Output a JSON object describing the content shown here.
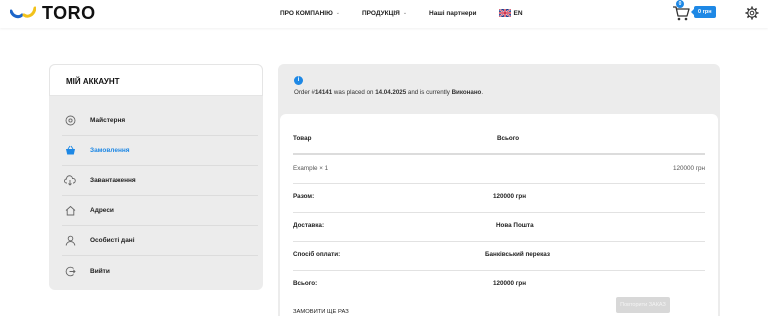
{
  "header": {
    "logo_text": "TORO",
    "nav": [
      {
        "label": "ПРО КОМПАНІЮ",
        "chevron": "⌄"
      },
      {
        "label": "ПРОДУКЦІЯ",
        "chevron": "⌄"
      },
      {
        "label": "Наші партнери",
        "chevron": ""
      }
    ],
    "lang": "EN",
    "cart_count": "0",
    "cart_total": "0 грн",
    "accent_color": "#1e88e5"
  },
  "sidebar": {
    "title": "МІЙ АККАУНТ",
    "items": [
      {
        "label": "Майстерня",
        "icon": "gauge-icon",
        "active": false
      },
      {
        "label": "Замовлення",
        "icon": "basket-icon",
        "active": true
      },
      {
        "label": "Завантаження",
        "icon": "cloud-download-icon",
        "active": false
      },
      {
        "label": "Адреси",
        "icon": "home-icon",
        "active": false
      },
      {
        "label": "Особисті дані",
        "icon": "user-icon",
        "active": false
      },
      {
        "label": "Вийти",
        "icon": "logout-icon",
        "active": false
      }
    ]
  },
  "order": {
    "notice_prefix": "Order #",
    "order_number": "14141",
    "notice_mid1": " was placed on ",
    "date": "14.04.2025",
    "notice_mid2": " and is currently ",
    "status": "Виконано",
    "notice_end": ".",
    "table": {
      "col_product": "Товар",
      "col_total": "Всього",
      "item_name": "Example × 1",
      "item_total": "120000 грн",
      "rows": [
        {
          "label": "Разом:",
          "value": "120000 грн"
        },
        {
          "label": "Доставка:",
          "value": "Нова Пошта"
        },
        {
          "label": "Спосіб оплати:",
          "value": "Банківський переказ"
        },
        {
          "label": "Всього:",
          "value": "120000 грн"
        }
      ]
    },
    "reorder_label": "ЗАМОВИТИ ЩЕ РАЗ",
    "reorder_button": "Повторити ЗАКАЗ"
  }
}
